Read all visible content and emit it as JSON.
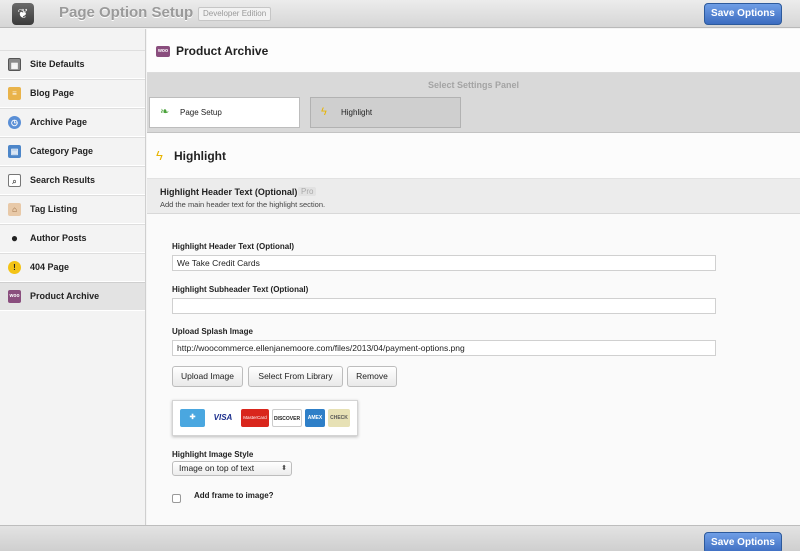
{
  "header": {
    "logo_glyph": "❦",
    "title": "Page Option Setup",
    "edition": "Developer Edition",
    "save_label": "Save Options"
  },
  "sidebar": {
    "items": [
      {
        "label": "Site Defaults",
        "icon": "grid-icon"
      },
      {
        "label": "Blog Page",
        "icon": "blog-icon"
      },
      {
        "label": "Archive Page",
        "icon": "clock-icon"
      },
      {
        "label": "Category Page",
        "icon": "stack-icon"
      },
      {
        "label": "Search Results",
        "icon": "search-box-icon"
      },
      {
        "label": "Tag Listing",
        "icon": "tag-icon"
      },
      {
        "label": "Author Posts",
        "icon": "person-icon"
      },
      {
        "label": "404 Page",
        "icon": "warning-icon"
      },
      {
        "label": "Product Archive",
        "icon": "woo-icon",
        "active": true
      }
    ],
    "warning_glyph": "!",
    "woo_text": "woo"
  },
  "main": {
    "title": "Product Archive",
    "panel_label": "Select Settings Panel",
    "tabs": [
      {
        "label": "Page Setup"
      },
      {
        "label": "Highlight",
        "active": true
      }
    ],
    "section_title": "Highlight",
    "option": {
      "title": "Highlight Header Text (Optional)",
      "badge": "Pro",
      "description": "Add the main header text for the highlight section."
    },
    "fields": {
      "header_label": "Highlight Header Text (Optional)",
      "header_value": "We Take Credit Cards",
      "subheader_label": "Highlight Subheader Text (Optional)",
      "subheader_value": "",
      "splash_label": "Upload Splash Image",
      "splash_value": "http://woocommerce.ellenjanemoore.com/files/2013/04/payment-options.png",
      "upload_btn": "Upload Image",
      "library_btn": "Select From Library",
      "remove_btn": "Remove",
      "style_label": "Highlight Image Style",
      "style_value": "Image on top of text",
      "frame_label": "Add frame to image?"
    },
    "payment_cards": [
      "VISA",
      "MasterCard",
      "DISCOVER",
      "AMEX",
      "CHECK"
    ]
  },
  "colors": {
    "accent": "#4a7bd0",
    "woo": "#8a4e7e",
    "highlight_bolt": "#e8b400"
  }
}
